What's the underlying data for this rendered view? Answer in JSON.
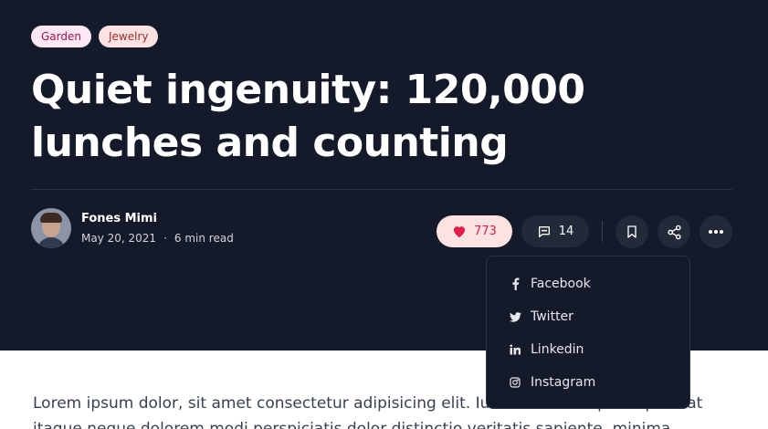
{
  "post": {
    "tags": [
      "Garden",
      "Jewelry"
    ],
    "title_line1": "Quiet ingenuity: 120,000",
    "title_line2": "lunches and counting",
    "author": {
      "name": "Fones Mimi",
      "date": "May 20, 2021",
      "separator": "·",
      "read_time": "6 min read"
    },
    "actions": {
      "likes": "773",
      "comments": "14"
    },
    "body_line1": "Lorem ipsum dolor, sit amet consectetur adipisicing elit. Iure vel officiis ipsum placeat",
    "body_line2": "itaque neque dolorem modi perspiciatis dolor distinctio veritatis sapiente, minima"
  },
  "share_menu": {
    "items": [
      {
        "label": "Facebook",
        "icon": "facebook-icon"
      },
      {
        "label": "Twitter",
        "icon": "twitter-icon"
      },
      {
        "label": "Linkedin",
        "icon": "linkedin-icon"
      },
      {
        "label": "Instagram",
        "icon": "instagram-icon"
      }
    ]
  },
  "colors": {
    "hero_bg": "#141a2a",
    "like_accent": "#e11d48",
    "tag_pink": "#fce7f3"
  }
}
